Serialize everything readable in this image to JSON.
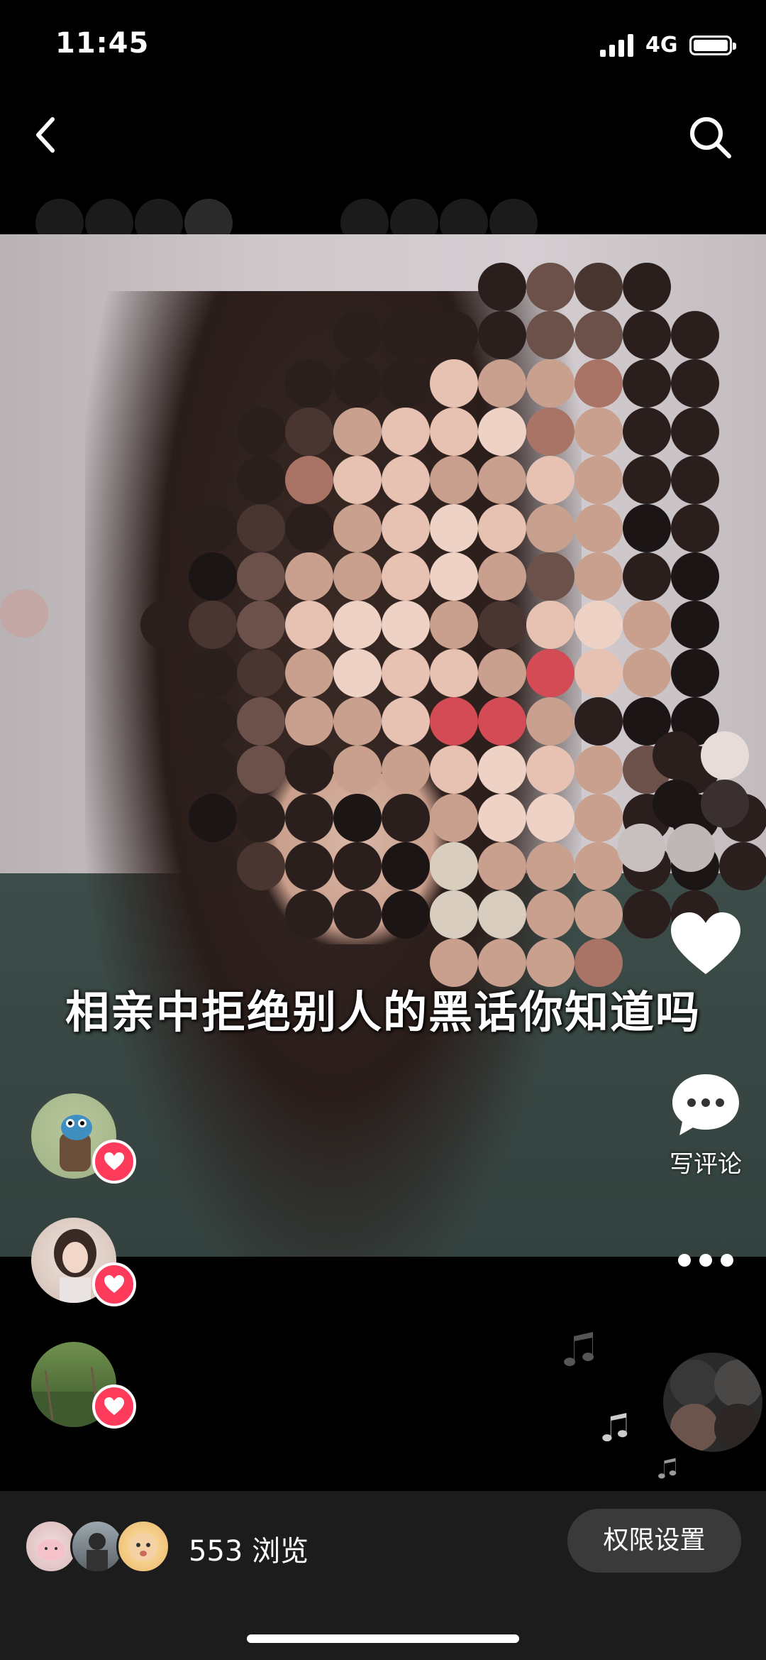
{
  "status_bar": {
    "time": "11:45",
    "network": "4G"
  },
  "nav": {
    "back_icon": "chevron-left-icon",
    "search_icon": "search-icon"
  },
  "video": {
    "caption": "相亲中拒绝别人的黑话你知道吗"
  },
  "actions": {
    "like_icon": "heart-icon",
    "comment_label": "写评论",
    "more_icon": "more-dots-icon"
  },
  "likers": [
    {
      "name": "liker-avatar-1"
    },
    {
      "name": "liker-avatar-2"
    },
    {
      "name": "liker-avatar-3"
    }
  ],
  "footer": {
    "views_count": "553",
    "views_label": "553 浏览",
    "permission_button": "权限设置"
  },
  "colors": {
    "like_badge": "#ff3b5c",
    "bottom_bar": "#1c1c1c",
    "button_bg": "#3a3a3a"
  }
}
